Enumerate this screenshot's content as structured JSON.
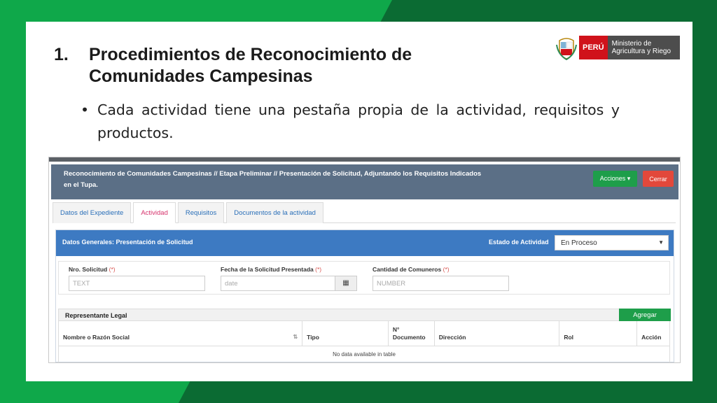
{
  "slide": {
    "title_number": "1.",
    "title_text": "Procedimientos de Reconocimiento de Comunidades Campesinas",
    "bullet_symbol": "•",
    "bullet_text": "Cada actividad tiene una pestaña propia de la actividad, requisitos y productos.",
    "logo": {
      "country": "PERÚ",
      "ministry": "Ministerio de Agricultura y Riego"
    }
  },
  "app": {
    "header_title": "Reconocimiento de Comunidades Campesinas // Etapa Preliminar // Presentación de Solicitud, Adjuntando los Requisitos Indicados en el Tupa.",
    "acciones_label": "Acciones ▾",
    "cerrar_label": "Cerrar",
    "tabs": [
      {
        "label": "Datos del Expediente"
      },
      {
        "label": "Actividad"
      },
      {
        "label": "Requisitos"
      },
      {
        "label": "Documentos de la actividad"
      }
    ],
    "panel": {
      "title": "Datos Generales: Presentación de Solicitud",
      "estado_label": "Estado de Actividad",
      "estado_value": "En Proceso",
      "fields": [
        {
          "label": "Nro. Solicitud",
          "req": "(*)",
          "placeholder": "TEXT"
        },
        {
          "label": "Fecha de la Solicitud Presentada",
          "req": "(*)",
          "placeholder": "date"
        },
        {
          "label": "Cantidad de Comuneros",
          "req": "(*)",
          "placeholder": "NUMBER"
        }
      ]
    },
    "representante": {
      "title": "Representante Legal",
      "agregar_label": "Agregar",
      "columns": [
        "Nombre o Razón Social",
        "Tipo",
        "N° Documento",
        "Dirección",
        "Rol",
        "Acción"
      ],
      "empty_text": "No data available in table"
    }
  }
}
